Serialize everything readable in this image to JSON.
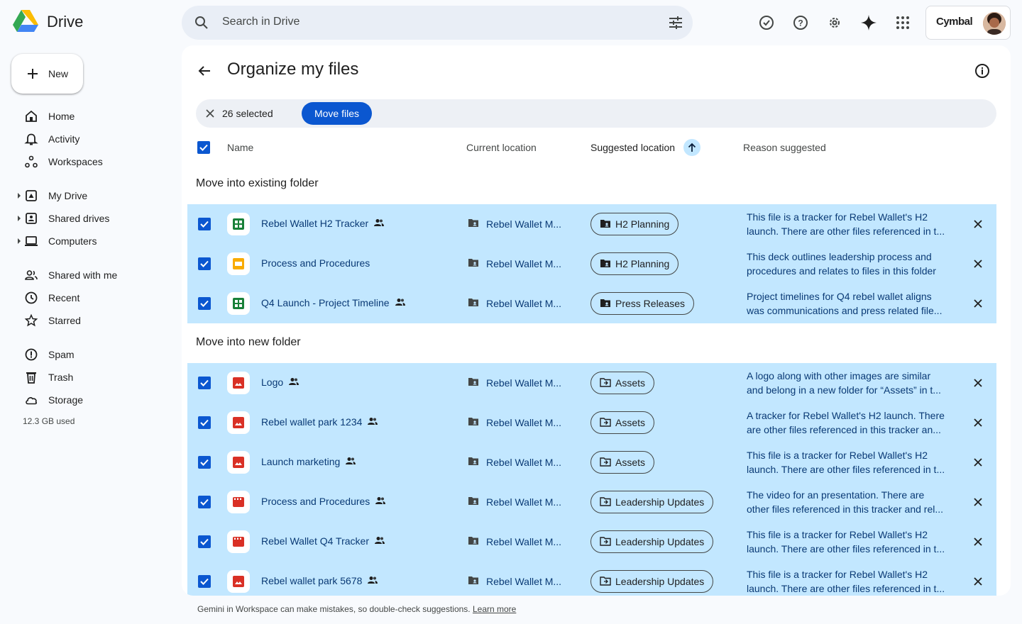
{
  "app": {
    "name": "Drive"
  },
  "search": {
    "placeholder": "Search in Drive"
  },
  "account": {
    "brand": "Cymbal"
  },
  "sidebar": {
    "new_label": "New",
    "items": [
      {
        "label": "Home",
        "icon": "home-icon"
      },
      {
        "label": "Activity",
        "icon": "bell-icon"
      },
      {
        "label": "Workspaces",
        "icon": "workspaces-icon"
      },
      {
        "label": "My Drive",
        "icon": "my-drive-icon"
      },
      {
        "label": "Shared drives",
        "icon": "shared-drives-icon"
      },
      {
        "label": "Computers",
        "icon": "computer-icon"
      },
      {
        "label": "Shared with me",
        "icon": "people-icon"
      },
      {
        "label": "Recent",
        "icon": "clock-icon"
      },
      {
        "label": "Starred",
        "icon": "star-icon"
      },
      {
        "label": "Spam",
        "icon": "spam-icon"
      },
      {
        "label": "Trash",
        "icon": "trash-icon"
      },
      {
        "label": "Storage",
        "icon": "cloud-icon"
      }
    ],
    "storage_used": "12.3 GB used"
  },
  "page": {
    "title": "Organize my files",
    "selected_count": "26 selected",
    "move_button": "Move files"
  },
  "columns": {
    "name": "Name",
    "current": "Current location",
    "suggested": "Suggested location",
    "reason": "Reason suggested"
  },
  "sections": [
    {
      "title": "Move into existing folder",
      "rows": [
        {
          "type": "sheets",
          "name": "Rebel Wallet H2 Tracker",
          "shared": true,
          "current": "Rebel Wallet M...",
          "suggested": "H2 Planning",
          "folder": "existing",
          "reason1": "This file is a tracker for Rebel Wallet's H2",
          "reason2": "launch. There are other files referenced in t..."
        },
        {
          "type": "slides",
          "name": "Process and Procedures",
          "shared": false,
          "current": "Rebel Wallet M...",
          "suggested": "H2 Planning",
          "folder": "existing",
          "reason1": "This deck outlines leadership process and",
          "reason2": "procedures and relates to files in this folder"
        },
        {
          "type": "sheets",
          "name": "Q4 Launch - Project Timeline",
          "shared": true,
          "current": "Rebel Wallet M...",
          "suggested": "Press Releases",
          "folder": "existing",
          "reason1": "Project timelines for Q4 rebel wallet aligns",
          "reason2": "was communications and press related file..."
        }
      ]
    },
    {
      "title": "Move into new folder",
      "rows": [
        {
          "type": "image",
          "name": "Logo",
          "shared": true,
          "current": "Rebel Wallet M...",
          "suggested": "Assets",
          "folder": "new",
          "reason1": "A logo along with other images are similar",
          "reason2": "and belong in a new folder for “Assets” in t..."
        },
        {
          "type": "image",
          "name": "Rebel wallet park 1234",
          "shared": true,
          "current": "Rebel Wallet M...",
          "suggested": "Assets",
          "folder": "new",
          "reason1": "A tracker for Rebel Wallet's H2 launch. There",
          "reason2": "are other files referenced in this tracker an..."
        },
        {
          "type": "image",
          "name": "Launch marketing",
          "shared": true,
          "current": "Rebel Wallet M...",
          "suggested": "Assets",
          "folder": "new",
          "reason1": "This file is a tracker for Rebel Wallet's H2",
          "reason2": "launch. There are other files referenced in t..."
        },
        {
          "type": "video",
          "name": "Process and Procedures",
          "shared": true,
          "current": "Rebel Wallet M...",
          "suggested": "Leadership Updates",
          "folder": "new",
          "reason1": "The video for an presentation. There are",
          "reason2": "other files referenced in this tracker and rel..."
        },
        {
          "type": "video",
          "name": "Rebel Wallet Q4 Tracker",
          "shared": true,
          "current": "Rebel Wallet M...",
          "suggested": "Leadership Updates",
          "folder": "new",
          "reason1": "This file is a tracker for Rebel Wallet's H2",
          "reason2": "launch. There are other files referenced in t..."
        },
        {
          "type": "image",
          "name": "Rebel wallet park 5678",
          "shared": true,
          "current": "Rebel Wallet M...",
          "suggested": "Leadership Updates",
          "folder": "new",
          "reason1": "This file is a tracker for Rebel Wallet's H2",
          "reason2": "launch. There are other files referenced in t..."
        }
      ]
    }
  ],
  "footer": {
    "text": "Gemini in Workspace can make mistakes, so double-check suggestions.",
    "link": "Learn more"
  },
  "colors": {
    "accent": "#0b57d0",
    "row_selected": "#c2e7ff",
    "sheets": "#188038",
    "slides": "#f9ab00",
    "media": "#d93025"
  }
}
